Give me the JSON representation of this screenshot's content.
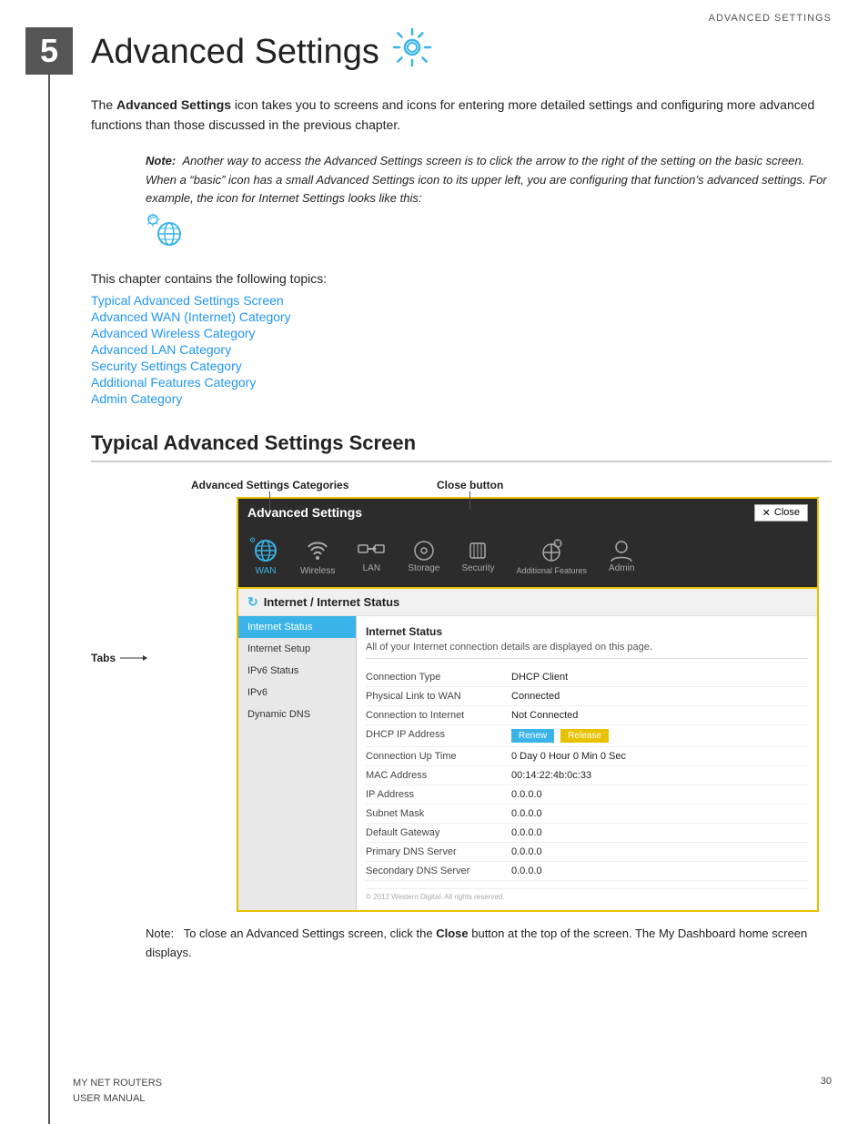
{
  "page": {
    "header_label": "ADVANCED SETTINGS",
    "chapter_number": "5",
    "chapter_title": "Advanced Settings",
    "footer_left_line1": "MY NET ROUTERS",
    "footer_left_line2": "USER MANUAL",
    "footer_right": "30"
  },
  "intro": {
    "text_before_bold": "The ",
    "bold_text": "Advanced Settings",
    "text_after_bold": " icon takes you to screens and icons for entering more detailed settings and configuring more advanced functions than those discussed in the previous chapter."
  },
  "note": {
    "label": "Note:",
    "content": "Another way to access the Advanced Settings screen is to click the arrow to the right of the setting on the basic screen. When a “basic” icon has a small Advanced Settings icon to its upper left, you are configuring that function’s advanced settings. For example, the icon for Internet Settings looks like this:"
  },
  "toc": {
    "intro": "This chapter contains the following topics:",
    "links": [
      "Typical Advanced Settings Screen",
      "Advanced WAN (Internet) Category",
      "Advanced Wireless Category",
      "Advanced LAN Category",
      "Security Settings Category",
      "Additional Features Category",
      "Admin Category"
    ]
  },
  "section": {
    "heading": "Typical Advanced Settings Screen"
  },
  "screenshot_labels": {
    "adv_cat_label": "Advanced Settings Categories",
    "close_btn_label": "Close button",
    "tabs_label": "Tabs"
  },
  "adv_ui": {
    "header_title": "Advanced Settings",
    "close_btn": "Close",
    "nav_items": [
      {
        "label": "WAN",
        "active": true
      },
      {
        "label": "Wireless",
        "active": false
      },
      {
        "label": "LAN",
        "active": false
      },
      {
        "label": "Storage",
        "active": false
      },
      {
        "label": "Security",
        "active": false
      },
      {
        "label": "Additional Features",
        "active": false
      },
      {
        "label": "Admin",
        "active": false
      }
    ],
    "section_title": "Internet / Internet Status",
    "sidebar_items": [
      {
        "label": "Internet Status",
        "active": true
      },
      {
        "label": "Internet Setup",
        "active": false
      },
      {
        "label": "IPv6 Status",
        "active": false
      },
      {
        "label": "IPv6",
        "active": false
      },
      {
        "label": "Dynamic DNS",
        "active": false
      }
    ],
    "main_section_header": "Internet Status",
    "main_section_desc": "All of your Internet connection details are displayed on this page.",
    "rows": [
      {
        "label": "Connection Type",
        "value": "DHCP Client",
        "type": "text"
      },
      {
        "label": "Physical Link to WAN",
        "value": "Connected",
        "type": "text"
      },
      {
        "label": "Connection to Internet",
        "value": "Not Connected",
        "type": "text"
      },
      {
        "label": "DHCP IP Address",
        "value": "",
        "type": "buttons"
      },
      {
        "label": "Connection Up Time",
        "value": "0 Day 0 Hour 0 Min 0 Sec",
        "type": "text"
      },
      {
        "label": "MAC Address",
        "value": "00:14:22:4b:0c:33",
        "type": "text"
      },
      {
        "label": "IP Address",
        "value": "0.0.0.0",
        "type": "text"
      },
      {
        "label": "Subnet Mask",
        "value": "0.0.0.0",
        "type": "text"
      },
      {
        "label": "Default Gateway",
        "value": "0.0.0.0",
        "type": "text"
      },
      {
        "label": "Primary DNS Server",
        "value": "0.0.0.0",
        "type": "text"
      },
      {
        "label": "Secondary DNS Server",
        "value": "0.0.0.0",
        "type": "text"
      }
    ],
    "btn_renew": "Renew",
    "btn_release": "Release"
  },
  "bottom_note": {
    "label": "Note:",
    "text_before_bold": "To close an Advanced Settings screen, click the ",
    "bold_text": "Close",
    "text_after_bold": " button at the top of the screen. The My Dashboard home screen displays."
  }
}
